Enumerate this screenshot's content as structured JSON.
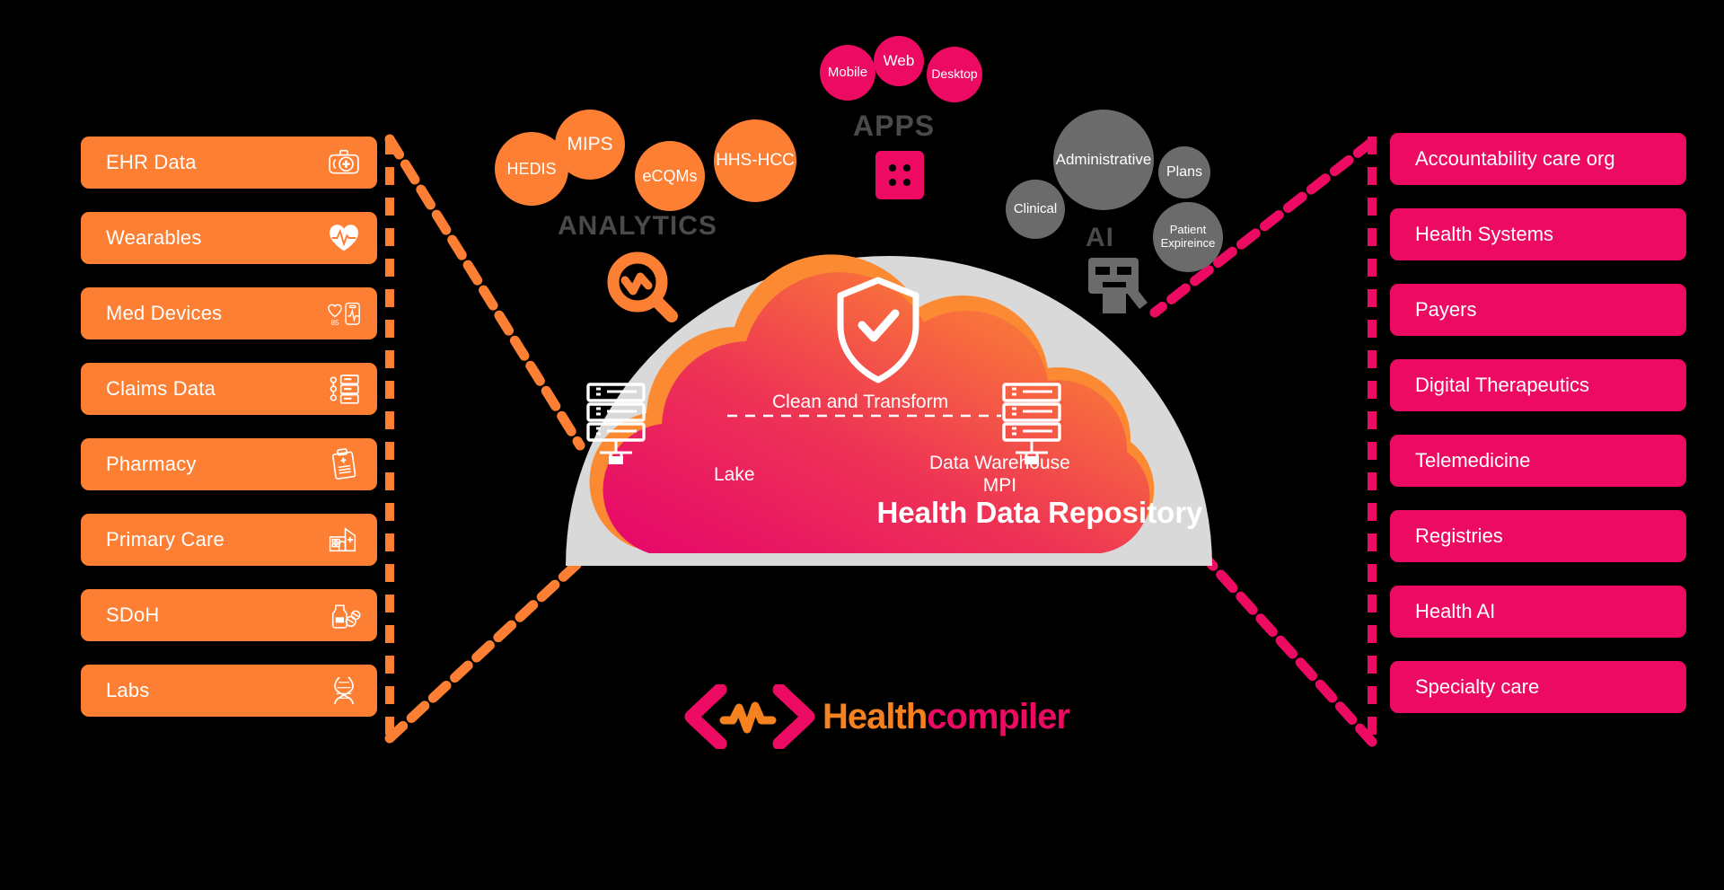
{
  "colors": {
    "orange": "#FC7F33",
    "pink": "#ED0A62",
    "gray": "#6B6B6B",
    "cloud_gray": "#D9D9D9",
    "caption_gray": "#4A4A4A",
    "background": "#000000",
    "logo_orange": "#F5821F",
    "logo_pink": "#ED0A62"
  },
  "left_sources": {
    "items": [
      {
        "label": "EHR Data",
        "icon": "medical-kit-icon"
      },
      {
        "label": "Wearables",
        "icon": "heart-pulse-icon"
      },
      {
        "label": "Med Devices",
        "icon": "heart-monitor-icon"
      },
      {
        "label": "Claims Data",
        "icon": "claims-list-icon"
      },
      {
        "label": "Pharmacy",
        "icon": "clipboard-rx-icon"
      },
      {
        "label": "Primary Care",
        "icon": "clinic-building-icon"
      },
      {
        "label": "SDoH",
        "icon": "bottle-pills-icon"
      },
      {
        "label": "Labs",
        "icon": "dna-icon"
      }
    ]
  },
  "right_consumers": {
    "items": [
      {
        "label": "Accountability care org"
      },
      {
        "label": "Health Systems"
      },
      {
        "label": "Payers"
      },
      {
        "label": "Digital Therapeutics"
      },
      {
        "label": "Telemedicine"
      },
      {
        "label": "Registries"
      },
      {
        "label": "Health AI"
      },
      {
        "label": "Specialty care"
      }
    ]
  },
  "analytics": {
    "caption": "ANALYTICS",
    "icon": "analytics-search-icon",
    "bubbles": [
      {
        "label": "HEDIS"
      },
      {
        "label": "MIPS"
      },
      {
        "label": "eCQMs"
      },
      {
        "label": "HHS-HCC"
      }
    ]
  },
  "apps": {
    "caption": "APPS",
    "icon": "apps-grid-icon",
    "bubbles": [
      {
        "label": "Mobile"
      },
      {
        "label": "Web"
      },
      {
        "label": "Desktop"
      }
    ]
  },
  "ai": {
    "caption": "AI",
    "icon": "robot-icon",
    "bubbles": [
      {
        "label": "Administrative"
      },
      {
        "label": "Plans"
      },
      {
        "label": "Clinical"
      },
      {
        "label": "Patient Expireince"
      }
    ]
  },
  "cloud": {
    "title": "Health Data Repository",
    "clean_transform": "Clean and Transform",
    "lake": "Lake",
    "data_warehouse_line1": "Data Warehouse",
    "data_warehouse_line2": "MPI",
    "shield_icon": "shield-check-icon",
    "lake_icon": "server-stack-icon",
    "warehouse_icon": "server-stack-icon"
  },
  "logo": {
    "word_1": "Health",
    "word_2": "compiler",
    "mark_icon": "code-pulse-logo-icon"
  }
}
